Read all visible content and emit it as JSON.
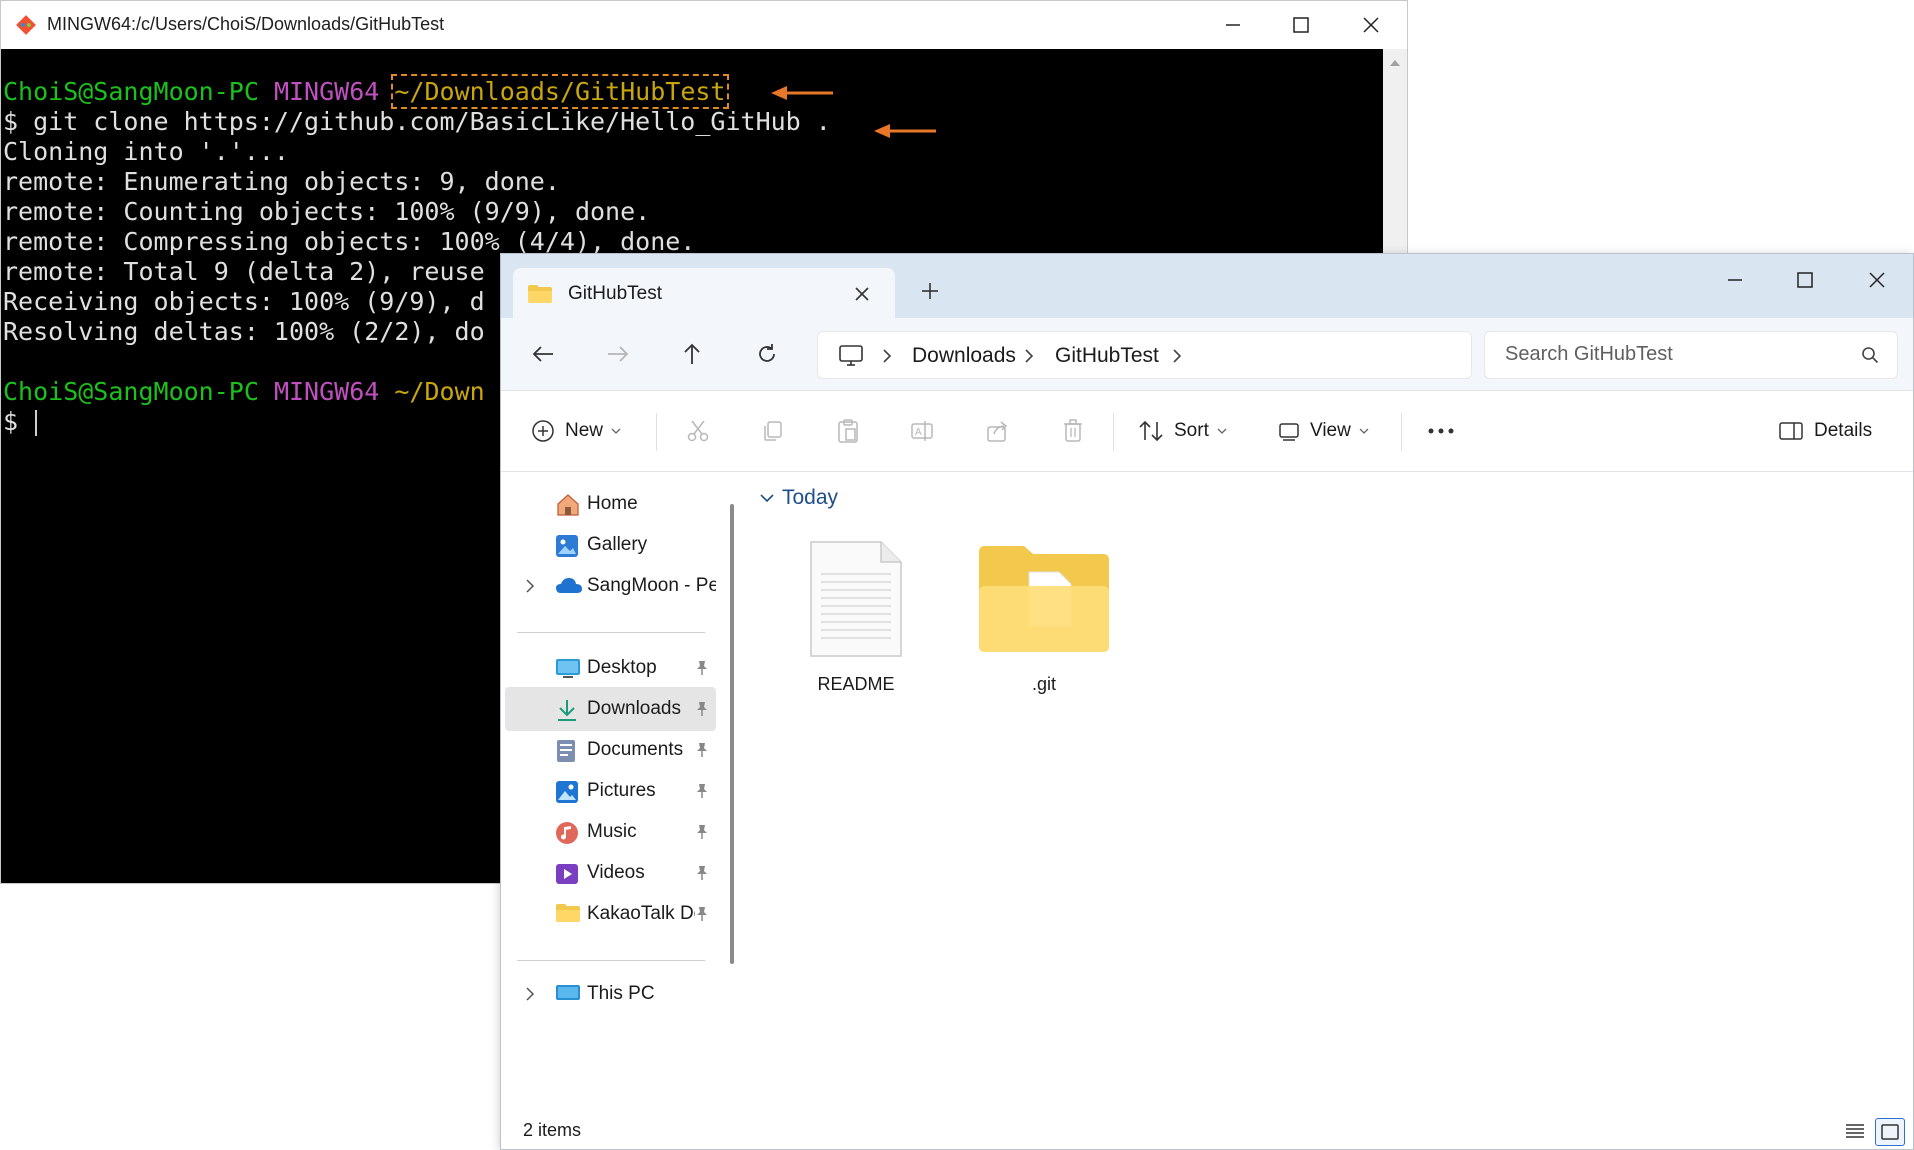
{
  "terminal": {
    "title": "MINGW64:/c/Users/ChoiS/Downloads/GitHubTest",
    "prompt1": {
      "user": "ChoiS@SangMoon-PC",
      "shell": "MINGW64",
      "path": "~/Downloads/GitHubTest"
    },
    "command": "$ git clone https://github.com/BasicLike/Hello_GitHub .",
    "output": [
      "Cloning into '.'...",
      "remote: Enumerating objects: 9, done.",
      "remote: Counting objects: 100% (9/9), done.",
      "remote: Compressing objects: 100% (4/4), done.",
      "remote: Total 9 (delta 2), reuse",
      "Receiving objects: 100% (9/9), d",
      "Resolving deltas: 100% (2/2), do"
    ],
    "prompt2": {
      "user": "ChoiS@SangMoon-PC",
      "shell": "MINGW64",
      "path": "~/Down"
    },
    "input_prompt": "$ ",
    "colors": {
      "user": "#1cc21c",
      "shell": "#c04fc0",
      "path": "#c9a60e",
      "annotation_arrow": "#e8772a"
    }
  },
  "explorer": {
    "tab": {
      "label": "GitHubTest"
    },
    "breadcrumb": [
      "Downloads",
      "GitHubTest"
    ],
    "search": {
      "placeholder": "Search GitHubTest"
    },
    "toolbar": {
      "new_label": "New",
      "sort_label": "Sort",
      "view_label": "View",
      "details_label": "Details"
    },
    "sidebar": {
      "top": [
        {
          "label": "Home",
          "icon": "home-icon"
        },
        {
          "label": "Gallery",
          "icon": "gallery-icon"
        },
        {
          "label": "SangMoon - Per",
          "icon": "onedrive-icon"
        }
      ],
      "pinned": [
        {
          "label": "Desktop",
          "icon": "desktop-icon"
        },
        {
          "label": "Downloads",
          "icon": "downloads-icon",
          "active": true
        },
        {
          "label": "Documents",
          "icon": "documents-icon"
        },
        {
          "label": "Pictures",
          "icon": "pictures-icon"
        },
        {
          "label": "Music",
          "icon": "music-icon"
        },
        {
          "label": "Videos",
          "icon": "videos-icon"
        },
        {
          "label": "KakaoTalk Dc",
          "icon": "folder-icon"
        }
      ],
      "bottom": [
        {
          "label": "This PC",
          "icon": "this-pc-icon"
        }
      ]
    },
    "group": {
      "label": "Today"
    },
    "files": [
      {
        "name": "README",
        "icon": "document-file-icon"
      },
      {
        "name": ".git",
        "icon": "folder-icon"
      }
    ],
    "status": {
      "count": "2 items"
    }
  }
}
